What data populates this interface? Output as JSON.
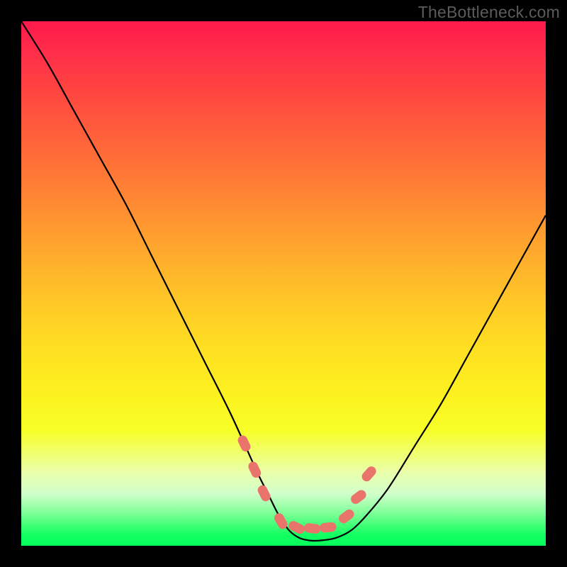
{
  "watermark": "TheBottleneck.com",
  "colors": {
    "frame": "#000000",
    "curve": "#000000",
    "marker_fill": "#e8746c",
    "marker_stroke": "#e8746c"
  },
  "chart_data": {
    "type": "line",
    "title": "",
    "xlabel": "",
    "ylabel": "",
    "xlim": [
      0,
      100
    ],
    "ylim": [
      0,
      100
    ],
    "grid": false,
    "x": [
      0,
      5,
      10,
      15,
      20,
      25,
      30,
      35,
      40,
      45,
      47,
      49,
      51,
      53,
      55,
      57,
      60,
      63,
      66,
      70,
      75,
      80,
      85,
      90,
      95,
      100
    ],
    "values": [
      100,
      92,
      83,
      74,
      65,
      55,
      45,
      35,
      25,
      14,
      10,
      6,
      3,
      1.5,
      1,
      1,
      1.5,
      3,
      6,
      11,
      19,
      27,
      36,
      45,
      54,
      63
    ],
    "markers": {
      "style": "rounded-pill",
      "x": [
        42.5,
        44.5,
        46.3,
        49.5,
        52.5,
        55.5,
        58.5,
        62.0,
        64.3,
        66.3
      ],
      "y": [
        19.5,
        14.5,
        10.0,
        4.7,
        3.5,
        3.3,
        3.5,
        5.6,
        9.3,
        13.7
      ]
    }
  }
}
